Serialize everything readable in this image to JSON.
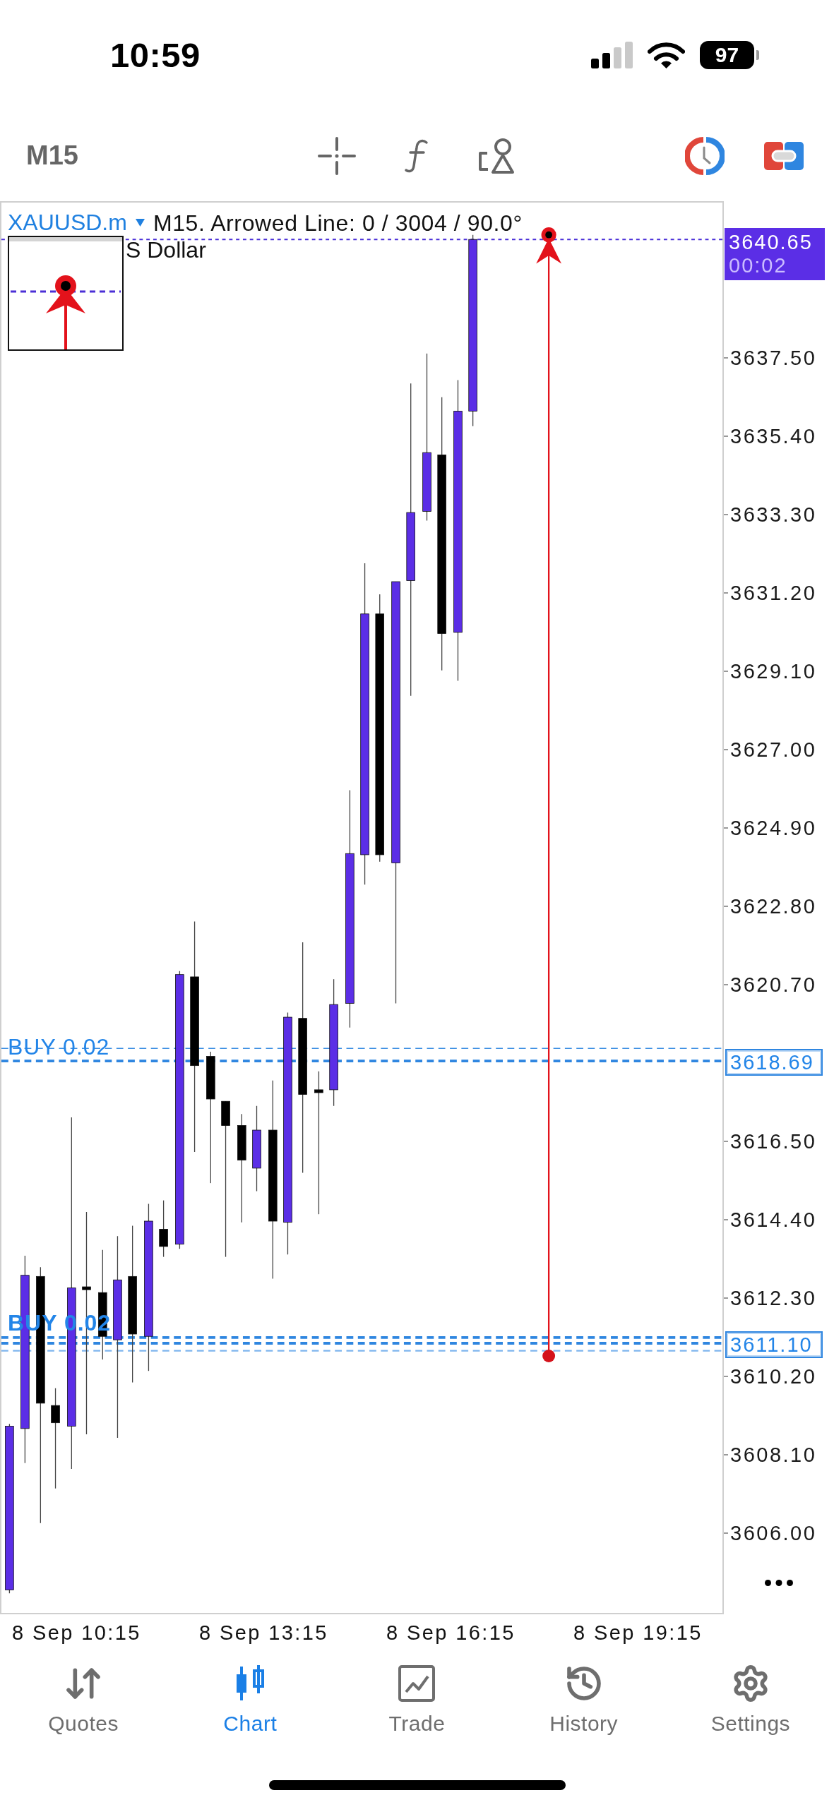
{
  "status_bar": {
    "time": "10:59",
    "battery": "97"
  },
  "toolbar": {
    "timeframe": "M15"
  },
  "chart": {
    "header": {
      "symbol": "XAUUSD.m",
      "info": "M15. Arrowed Line: 0 / 3004 / 90.0°"
    },
    "description": "S Dollar",
    "orders": [
      {
        "label": "BUY 0.02"
      },
      {
        "label": "BUY 0.02"
      }
    ],
    "price_tags": [
      {
        "kind": "bid",
        "price": "3640.65",
        "timer": "00:02"
      },
      {
        "kind": "order",
        "price": "3618.69"
      },
      {
        "kind": "order",
        "price": "3611.10"
      }
    ],
    "price_axis": {
      "upper_labels": [
        "3637.50",
        "3635.40",
        "3633.30",
        "3631.20",
        "3629.10",
        "3627.00",
        "3624.90",
        "3622.80",
        "3620.70"
      ],
      "lower_labels": [
        "3616.50",
        "3614.40",
        "3612.30",
        "3610.20",
        "3608.10",
        "3606.00"
      ]
    },
    "time_axis": [
      "8 Sep 10:15",
      "8 Sep 13:15",
      "8 Sep 16:15",
      "8 Sep 19:15"
    ]
  },
  "tab_bar": {
    "tabs": [
      {
        "label": "Quotes",
        "selected": false
      },
      {
        "label": "Chart",
        "selected": true
      },
      {
        "label": "Trade",
        "selected": false
      },
      {
        "label": "History",
        "selected": false
      },
      {
        "label": "Settings",
        "selected": false
      }
    ]
  }
}
